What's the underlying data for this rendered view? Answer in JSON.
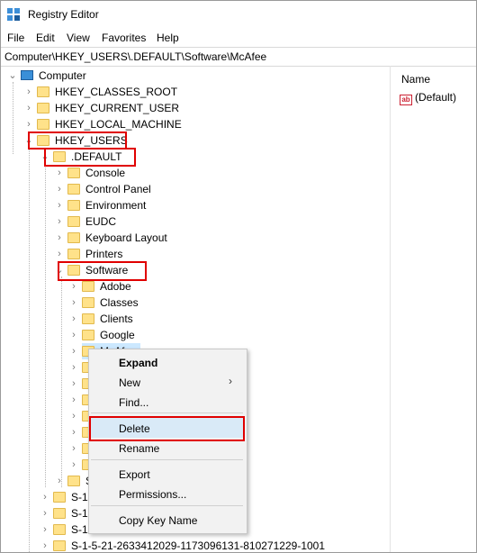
{
  "window": {
    "title": "Registry Editor"
  },
  "menu": [
    "File",
    "Edit",
    "View",
    "Favorites",
    "Help"
  ],
  "address": "Computer\\HKEY_USERS\\.DEFAULT\\Software\\McAfee",
  "tree": {
    "root": "Computer",
    "hives": [
      "HKEY_CLASSES_ROOT",
      "HKEY_CURRENT_USER",
      "HKEY_LOCAL_MACHINE",
      "HKEY_USERS"
    ],
    "default_key": ".DEFAULT",
    "default_children": [
      "Console",
      "Control Panel",
      "Environment",
      "EUDC",
      "Keyboard Layout",
      "Printers",
      "Software"
    ],
    "software_children": [
      "Adobe",
      "Classes",
      "Clients",
      "Google",
      "McAfee"
    ],
    "bottom_items": [
      "S",
      "S-1-",
      "S-1-",
      "S-1-",
      "S-1-5-21-2633412029-1173096131-810271229-1001"
    ]
  },
  "right_pane": {
    "column_name": "Name",
    "value_icon": "ab",
    "value_name": "(Default)"
  },
  "context_menu": {
    "expand": "Expand",
    "new": "New",
    "find": "Find...",
    "delete": "Delete",
    "rename": "Rename",
    "export": "Export",
    "permissions": "Permissions...",
    "copy_key_name": "Copy Key Name"
  },
  "colors": {
    "highlight": "#e00000",
    "folder": "#ffe28a",
    "selection": "#cce8ff"
  }
}
